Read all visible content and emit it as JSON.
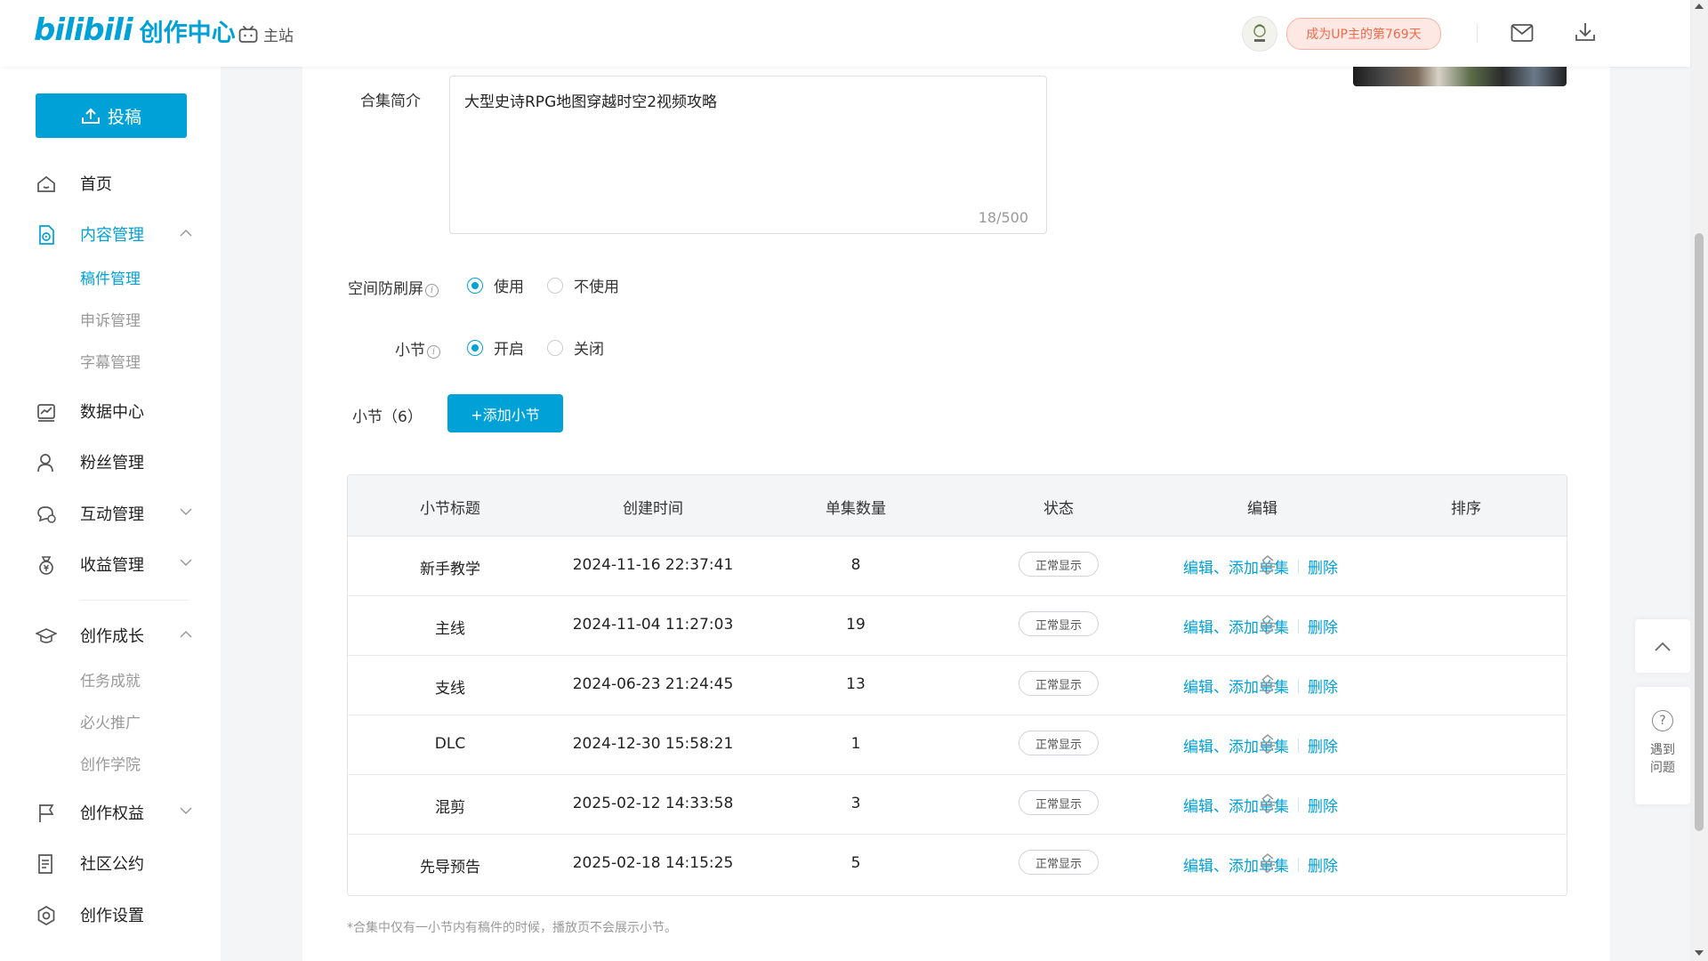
{
  "header": {
    "logo_mark": "bilibili",
    "logo_text": "创作中心",
    "home_link": "主站",
    "up_badge": "成为UP主的第769天"
  },
  "sidebar": {
    "post_button": "投稿",
    "items": [
      {
        "label": "首页",
        "icon": "home-icon"
      },
      {
        "label": "内容管理",
        "icon": "content-icon",
        "active": true
      },
      {
        "label": "数据中心",
        "icon": "chart-icon"
      },
      {
        "label": "粉丝管理",
        "icon": "user-icon"
      },
      {
        "label": "互动管理",
        "icon": "chat-icon"
      },
      {
        "label": "收益管理",
        "icon": "money-bag-icon"
      },
      {
        "label": "创作成长",
        "icon": "graduation-cap-icon"
      },
      {
        "label": "创作权益",
        "icon": "flag-icon"
      },
      {
        "label": "社区公约",
        "icon": "document-icon"
      },
      {
        "label": "创作设置",
        "icon": "gear-icon"
      }
    ],
    "content_sub": [
      "稿件管理",
      "申诉管理",
      "字幕管理"
    ],
    "growth_sub": [
      "任务成就",
      "必火推广",
      "创作学院"
    ]
  },
  "form": {
    "intro_label": "合集简介",
    "intro_value": "大型史诗RPG地图穿越时空2视频攻略",
    "intro_count": "18/500",
    "antispam_label": "空间防刷屏",
    "antispam_options": [
      "使用",
      "不使用"
    ],
    "antispam_selected": "使用",
    "section_label": "小节",
    "section_options": [
      "开启",
      "关闭"
    ],
    "section_selected": "开启",
    "section_count_label": "小节（6）",
    "add_section_button": "+添加小节"
  },
  "table": {
    "headers": [
      "小节标题",
      "创建时间",
      "单集数量",
      "状态",
      "编辑",
      "排序"
    ],
    "rows": [
      {
        "title": "新手教学",
        "created": "2024-11-16 22:37:41",
        "count": "8",
        "status": "正常显示"
      },
      {
        "title": "主线",
        "created": "2024-11-04 11:27:03",
        "count": "19",
        "status": "正常显示"
      },
      {
        "title": "支线",
        "created": "2024-06-23 21:24:45",
        "count": "13",
        "status": "正常显示"
      },
      {
        "title": "DLC",
        "created": "2024-12-30 15:58:21",
        "count": "1",
        "status": "正常显示"
      },
      {
        "title": "混剪",
        "created": "2025-02-12 14:33:58",
        "count": "3",
        "status": "正常显示"
      },
      {
        "title": "先导预告",
        "created": "2025-02-18 14:15:25",
        "count": "5",
        "status": "正常显示"
      }
    ],
    "op_edit": "编辑",
    "op_add": "、添加单集",
    "op_delete": "删除"
  },
  "footnote": "*合集中仅有一小节内有稿件的时候，播放页不会展示小节。",
  "float": {
    "help_label_1": "遇到",
    "help_label_2": "问题"
  },
  "colors": {
    "accent": "#00a1d6",
    "badge_text": "#f2694c",
    "badge_bg": "#fde8e4"
  }
}
